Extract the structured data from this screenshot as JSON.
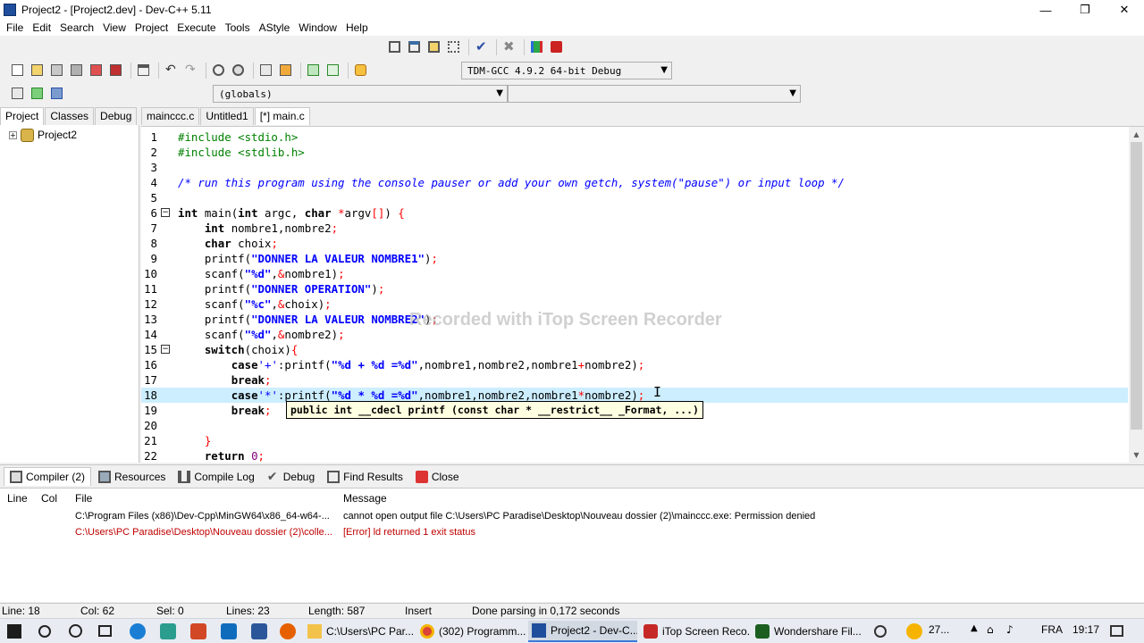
{
  "window": {
    "title": "Project2 - [Project2.dev] - Dev-C++ 5.11",
    "controls": {
      "minimize": "—",
      "maximize": "❐",
      "close": "✕"
    }
  },
  "menu": [
    "File",
    "Edit",
    "Search",
    "View",
    "Project",
    "Execute",
    "Tools",
    "AStyle",
    "Window",
    "Help"
  ],
  "compiler_select": {
    "value": "TDM-GCC 4.9.2 64-bit Debug"
  },
  "scope_select": {
    "value": "(globals)",
    "function_value": ""
  },
  "left_panel": {
    "tabs": [
      "Project",
      "Classes",
      "Debug"
    ],
    "tree": [
      {
        "label": "Project2",
        "expander": "+"
      }
    ]
  },
  "editor_tabs": [
    "mainccc.c",
    "Untitled1",
    "[*] main.c"
  ],
  "code": [
    {
      "n": "1",
      "html": "<span class=\"pp\">#include &lt;stdio.h&gt;</span>"
    },
    {
      "n": "2",
      "html": "<span class=\"pp\">#include &lt;stdlib.h&gt;</span>"
    },
    {
      "n": "3",
      "html": ""
    },
    {
      "n": "4",
      "html": "<span class=\"cm\">/* run this program using the console pauser or add your own getch, system(\"pause\") or input loop */</span>"
    },
    {
      "n": "5",
      "html": ""
    },
    {
      "n": "6",
      "fold": "−",
      "html": "<span class=\"kw\">int</span> main(<span class=\"kw\">int</span> argc, <span class=\"kw\">char</span> <span class=\"sym\">*</span>argv<span class=\"sym\">[]</span>) <span class=\"sym\">{</span>"
    },
    {
      "n": "7",
      "html": "    <span class=\"kw\">int</span> nombre1,nombre2<span class=\"sym\">;</span>"
    },
    {
      "n": "8",
      "html": "    <span class=\"kw\">char</span> choix<span class=\"sym\">;</span>"
    },
    {
      "n": "9",
      "html": "    printf(<span class=\"str\"><b>\"DONNER LA VALEUR NOMBRE1\"</b></span>)<span class=\"sym\">;</span>"
    },
    {
      "n": "10",
      "html": "    scanf(<span class=\"str\"><b>\"%d\"</b></span>,<span class=\"sym\">&amp;</span>nombre1)<span class=\"sym\">;</span>"
    },
    {
      "n": "11",
      "html": "    printf(<span class=\"str\"><b>\"DONNER OPERATION\"</b></span>)<span class=\"sym\">;</span>"
    },
    {
      "n": "12",
      "html": "    scanf(<span class=\"str\"><b>\"%c\"</b></span>,<span class=\"sym\">&amp;</span>choix)<span class=\"sym\">;</span>"
    },
    {
      "n": "13",
      "html": "    printf(<span class=\"str\"><b>\"DONNER LA VALEUR NOMBRE2\"</b></span>)<span class=\"sym\">;</span>"
    },
    {
      "n": "14",
      "html": "    scanf(<span class=\"str\"><b>\"%d\"</b></span>,<span class=\"sym\">&amp;</span>nombre2)<span class=\"sym\">;</span>"
    },
    {
      "n": "15",
      "fold": "−",
      "html": "    <span class=\"kw\">switch</span>(choix)<span class=\"sym\">{</span>"
    },
    {
      "n": "16",
      "html": "        <span class=\"kw\">case</span><span class=\"str\">'+'</span>:printf(<span class=\"str\"><b>\"%d + %d =%d\"</b></span>,nombre1,nombre2,nombre1<span class=\"sym\">+</span>nombre2)<span class=\"sym\">;</span>"
    },
    {
      "n": "17",
      "html": "        <span class=\"kw\">break</span><span class=\"sym\">;</span>"
    },
    {
      "n": "18",
      "current": true,
      "html": "        <span class=\"kw\">case</span><span class=\"str\">'*'</span>:printf(<span class=\"str\"><b>\"%d * %d =%d\"</b></span>,nombre1,nombre2,nombre1<span class=\"sym\">*</span>nombre2)<span class=\"sym\">;</span>"
    },
    {
      "n": "19",
      "html": "        <span class=\"kw\">break</span><span class=\"sym\">;</span>"
    },
    {
      "n": "20",
      "html": ""
    },
    {
      "n": "21",
      "html": "    <span class=\"sym\">}</span>"
    },
    {
      "n": "22",
      "html": "    <span class=\"kw\">return</span> <span class=\"num\">0</span><span class=\"sym\">;</span>"
    }
  ],
  "tooltip": "public int __cdecl printf (const char * __restrict__ _Format, ...)",
  "watermark": "Recorded with iTop Screen Recorder",
  "bottom_tabs": [
    "Compiler (2)",
    "Resources",
    "Compile Log",
    "Debug",
    "Find Results",
    "Close"
  ],
  "messages": {
    "headers": {
      "line": "Line",
      "col": "Col",
      "file": "File",
      "message": "Message"
    },
    "rows": [
      {
        "line": "",
        "col": "",
        "file": "C:\\Program Files (x86)\\Dev-Cpp\\MinGW64\\x86_64-w64-...",
        "message": "cannot open output file C:\\Users\\PC Paradise\\Desktop\\Nouveau dossier (2)\\mainccc.exe: Permission denied",
        "error": false
      },
      {
        "line": "",
        "col": "",
        "file": "C:\\Users\\PC Paradise\\Desktop\\Nouveau dossier (2)\\colle...",
        "message": "[Error] ld returned 1 exit status",
        "error": true
      }
    ]
  },
  "status": {
    "line": "Line:    18",
    "col": "Col:    62",
    "sel": "Sel:    0",
    "lines": "Lines:    23",
    "length": "Length:    587",
    "mode": "Insert",
    "parse": "Done parsing in 0,172 seconds"
  },
  "taskbar": {
    "apps": [
      {
        "label": "C:\\Users\\PC Par...",
        "active": false
      },
      {
        "label": "(302) Programm...",
        "active": false
      },
      {
        "label": "Project2 - Dev-C...",
        "active": true
      },
      {
        "label": "iTop Screen Reco...",
        "active": false
      },
      {
        "label": "Wondershare Fil...",
        "active": false
      }
    ],
    "weather": "27...",
    "lang": "FRA",
    "time": "19:17"
  },
  "colors": {
    "accent": "#3b78d8",
    "current_line": "#cceeff",
    "error": "#c00000"
  }
}
